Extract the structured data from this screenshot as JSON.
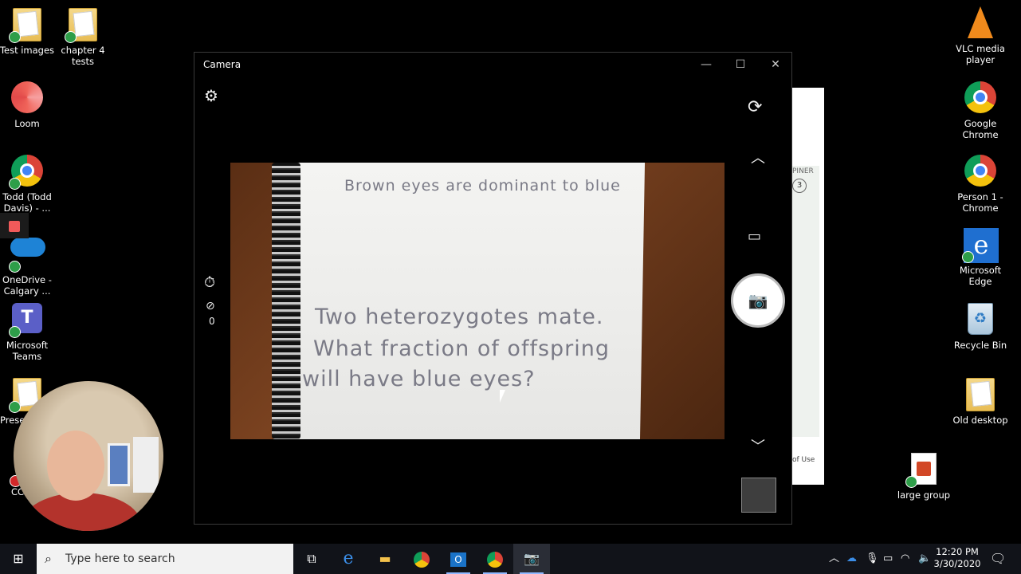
{
  "desktop_left": [
    {
      "label": "Test images"
    },
    {
      "label": "chapter 4\ntests"
    },
    {
      "label": "Loom"
    },
    {
      "label": "Todd (Todd\nDavis) - ..."
    },
    {
      "label": "OneDrive -\nCalgary ..."
    },
    {
      "label": "Microsoft\nTeams"
    },
    {
      "label": "Prese"
    },
    {
      "label": "CC"
    }
  ],
  "desktop_right": [
    {
      "label": "VLC media\nplayer"
    },
    {
      "label": "Google\nChrome"
    },
    {
      "label": "Person 1 -\nChrome"
    },
    {
      "label": "Microsoft\nEdge"
    },
    {
      "label": "Recycle Bin"
    },
    {
      "label": "Old desktop"
    },
    {
      "label": "large group"
    }
  ],
  "bg_window": {
    "text1": "PINER",
    "circle": "3",
    "text2": "of Use"
  },
  "camera": {
    "title": "Camera",
    "photo_count": "0",
    "note_line1": "Brown eyes are dominant to blue",
    "note_line2": "Two heterozygotes mate.",
    "note_line3": "What fraction of offspring",
    "note_line4": "will have blue eyes?"
  },
  "taskbar": {
    "search_placeholder": "Type here to search",
    "time": "12:20 PM",
    "date": "3/30/2020"
  }
}
